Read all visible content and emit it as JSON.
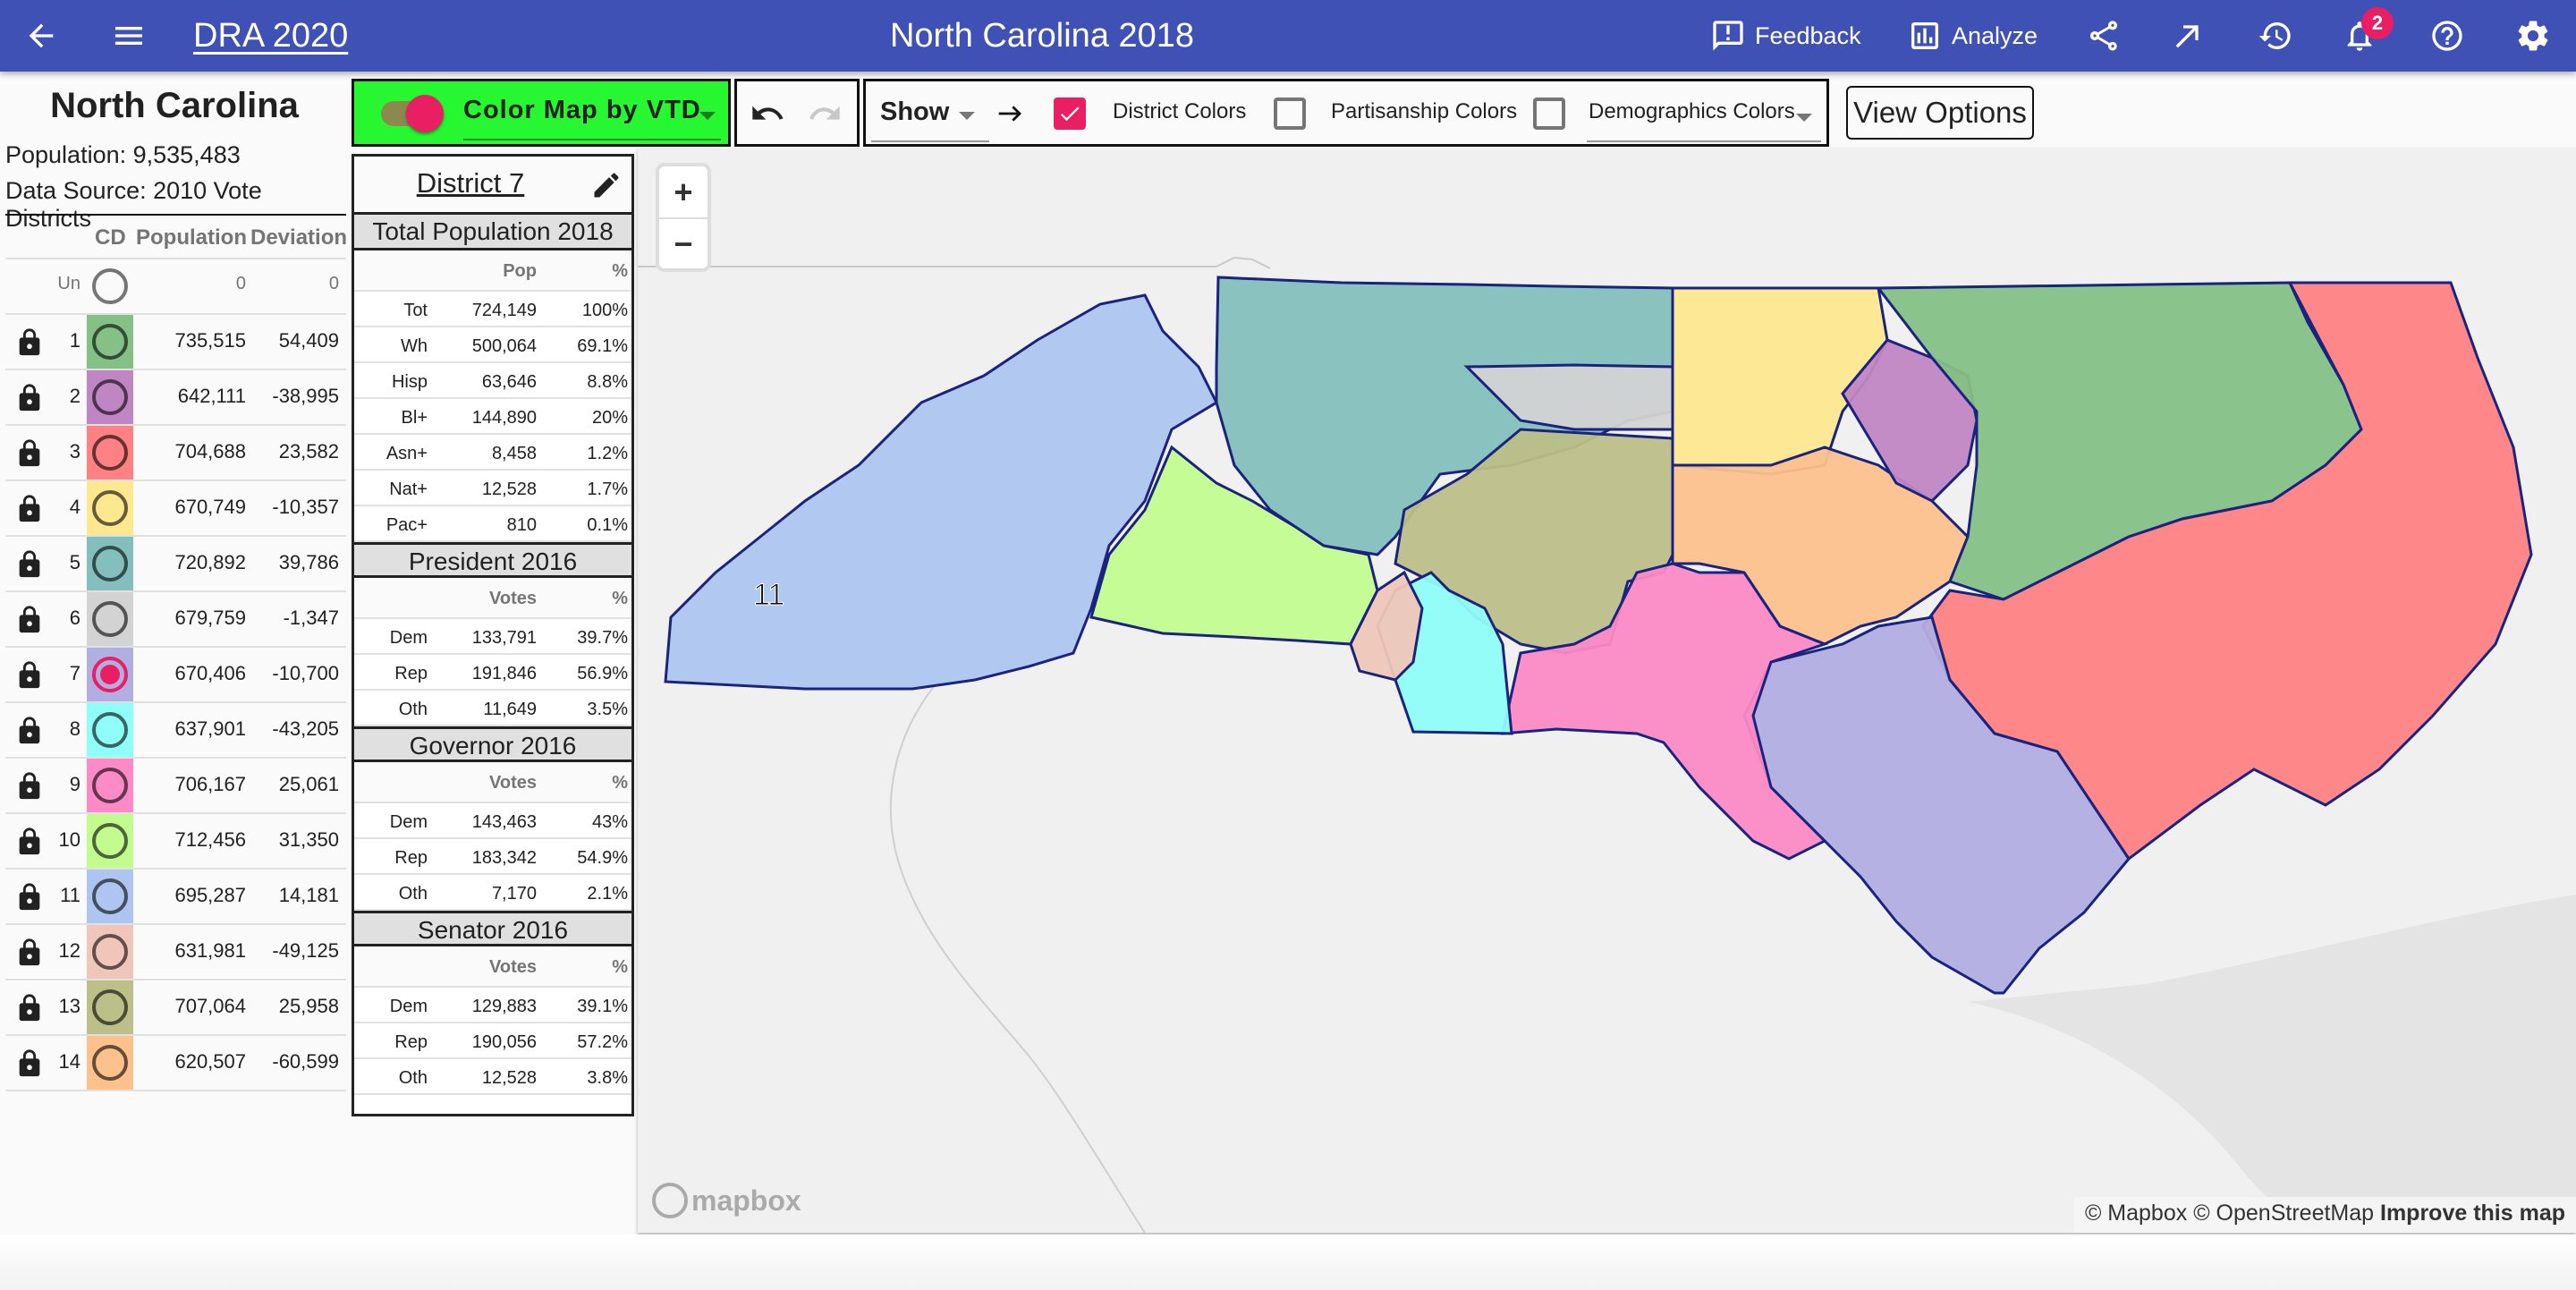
{
  "appbar": {
    "back_icon": "arrow-left-icon",
    "menu_icon": "hamburger-menu-icon",
    "brand": "DRA 2020",
    "title": "North Carolina 2018",
    "feedback_label": "Feedback",
    "analyze_label": "Analyze",
    "icons": [
      "share-icon",
      "open-external-icon",
      "history-icon",
      "notifications-icon",
      "help-icon",
      "settings-icon"
    ],
    "notification_count": "2",
    "background_color": "#3F51B5"
  },
  "left_panel": {
    "state": "North Carolina",
    "population": "Population: 9,535,483",
    "data_source": "Data Source: 2010 Vote Districts",
    "headers": {
      "cd": "CD",
      "population": "Population",
      "deviation": "Deviation"
    },
    "unassigned": {
      "label": "Un",
      "population": "0",
      "deviation": "0"
    },
    "districts": [
      {
        "num": "1",
        "population": "735,515",
        "deviation": "54,409",
        "color": "#85c087",
        "locked": true
      },
      {
        "num": "2",
        "population": "642,111",
        "deviation": "-38,995",
        "color": "#c086c3",
        "locked": true
      },
      {
        "num": "3",
        "population": "704,688",
        "deviation": "23,582",
        "color": "#fe8183",
        "locked": true
      },
      {
        "num": "4",
        "population": "670,749",
        "deviation": "-10,357",
        "color": "#fde78f",
        "locked": true
      },
      {
        "num": "5",
        "population": "720,892",
        "deviation": "39,786",
        "color": "#84bfbd",
        "locked": true
      },
      {
        "num": "6",
        "population": "679,759",
        "deviation": "-1,347",
        "color": "#d3d3d3",
        "locked": true
      },
      {
        "num": "7",
        "population": "670,406",
        "deviation": "-10,700",
        "color": "#b1aee2",
        "locked": true,
        "selected": true
      },
      {
        "num": "8",
        "population": "637,901",
        "deviation": "-43,205",
        "color": "#8ffdf8",
        "locked": true
      },
      {
        "num": "9",
        "population": "706,167",
        "deviation": "25,061",
        "color": "#fb8ac6",
        "locked": true
      },
      {
        "num": "10",
        "population": "712,456",
        "deviation": "31,350",
        "color": "#c2fc8f",
        "locked": true
      },
      {
        "num": "11",
        "population": "695,287",
        "deviation": "14,181",
        "color": "#adc5f0",
        "locked": true
      },
      {
        "num": "12",
        "population": "631,981",
        "deviation": "-49,125",
        "color": "#efc6b9",
        "locked": true
      },
      {
        "num": "13",
        "population": "707,064",
        "deviation": "25,958",
        "color": "#bcbf88",
        "locked": true
      },
      {
        "num": "14",
        "population": "620,507",
        "deviation": "-60,599",
        "color": "#fcc18d",
        "locked": true
      }
    ]
  },
  "toolbar": {
    "color_by": "Color Map by VTD",
    "color_by_toggle_on": true,
    "undo_icon": "undo-icon",
    "redo_icon": "redo-icon",
    "show_label": "Show",
    "arrow_icon": "arrow-right-icon",
    "district_colors": {
      "label": "District Colors",
      "checked": true
    },
    "partisanship_colors": {
      "label": "Partisanship Colors",
      "checked": false
    },
    "demographics_colors": {
      "label": "Demographics Colors",
      "checked": false
    },
    "view_options": "View Options"
  },
  "stats": {
    "district_title": "District 7",
    "sections": [
      {
        "title": "Total Population 2018",
        "col2": "Pop",
        "col3": "%",
        "rows": [
          [
            "Tot",
            "724,149",
            "100%"
          ],
          [
            "Wh",
            "500,064",
            "69.1%"
          ],
          [
            "Hisp",
            "63,646",
            "8.8%"
          ],
          [
            "Bl+",
            "144,890",
            "20%"
          ],
          [
            "Asn+",
            "8,458",
            "1.2%"
          ],
          [
            "Nat+",
            "12,528",
            "1.7%"
          ],
          [
            "Pac+",
            "810",
            "0.1%"
          ]
        ]
      },
      {
        "title": "President 2016",
        "col2": "Votes",
        "col3": "%",
        "rows": [
          [
            "Dem",
            "133,791",
            "39.7%"
          ],
          [
            "Rep",
            "191,846",
            "56.9%"
          ],
          [
            "Oth",
            "11,649",
            "3.5%"
          ]
        ]
      },
      {
        "title": "Governor 2016",
        "col2": "Votes",
        "col3": "%",
        "rows": [
          [
            "Dem",
            "143,463",
            "43%"
          ],
          [
            "Rep",
            "183,342",
            "54.9%"
          ],
          [
            "Oth",
            "7,170",
            "2.1%"
          ]
        ]
      },
      {
        "title": "Senator 2016",
        "col2": "Votes",
        "col3": "%",
        "rows": [
          [
            "Dem",
            "129,883",
            "39.1%"
          ],
          [
            "Rep",
            "190,056",
            "57.2%"
          ],
          [
            "Oth",
            "12,528",
            "3.8%"
          ]
        ]
      }
    ]
  },
  "map": {
    "zoom_in": "+",
    "zoom_out": "−",
    "district_label": "11",
    "logo": "mapbox",
    "attribution": "© Mapbox © OpenStreetMap",
    "improve": "Improve this map"
  }
}
